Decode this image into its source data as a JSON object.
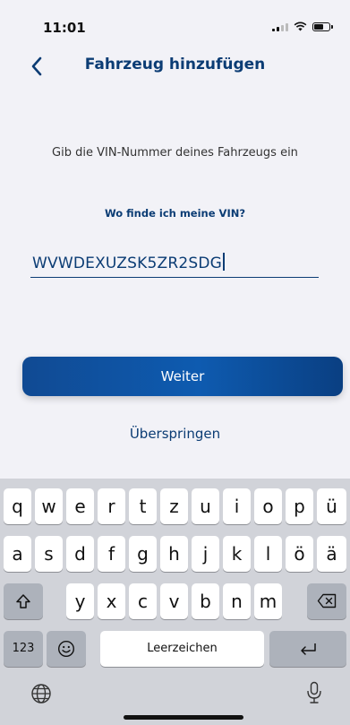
{
  "status_bar": {
    "time": "11:01"
  },
  "nav": {
    "title": "Fahrzeug hinzufügen"
  },
  "form": {
    "instruction": "Gib die VIN-Nummer deines Fahrzeugs ein",
    "help_link": "Wo finde ich meine VIN?",
    "vin_value": "WVWDEXUZSK5ZR2SDG"
  },
  "actions": {
    "continue_label": "Weiter",
    "skip_label": "Überspringen"
  },
  "keyboard": {
    "row1": [
      "q",
      "w",
      "e",
      "r",
      "t",
      "z",
      "u",
      "i",
      "o",
      "p",
      "ü"
    ],
    "row2": [
      "a",
      "s",
      "d",
      "f",
      "g",
      "h",
      "j",
      "k",
      "l",
      "ö",
      "ä"
    ],
    "row3": [
      "y",
      "x",
      "c",
      "v",
      "b",
      "n",
      "m"
    ],
    "numbers_label": "123",
    "space_label": "Leerzeichen"
  },
  "icons": {
    "back": "chevron-left-icon",
    "shift": "shift-icon",
    "delete": "backspace-icon",
    "emoji": "emoji-icon",
    "return": "return-icon",
    "globe": "globe-icon",
    "mic": "microphone-icon"
  },
  "colors": {
    "brand": "#0b3c74",
    "button": "#0e5bb0"
  }
}
